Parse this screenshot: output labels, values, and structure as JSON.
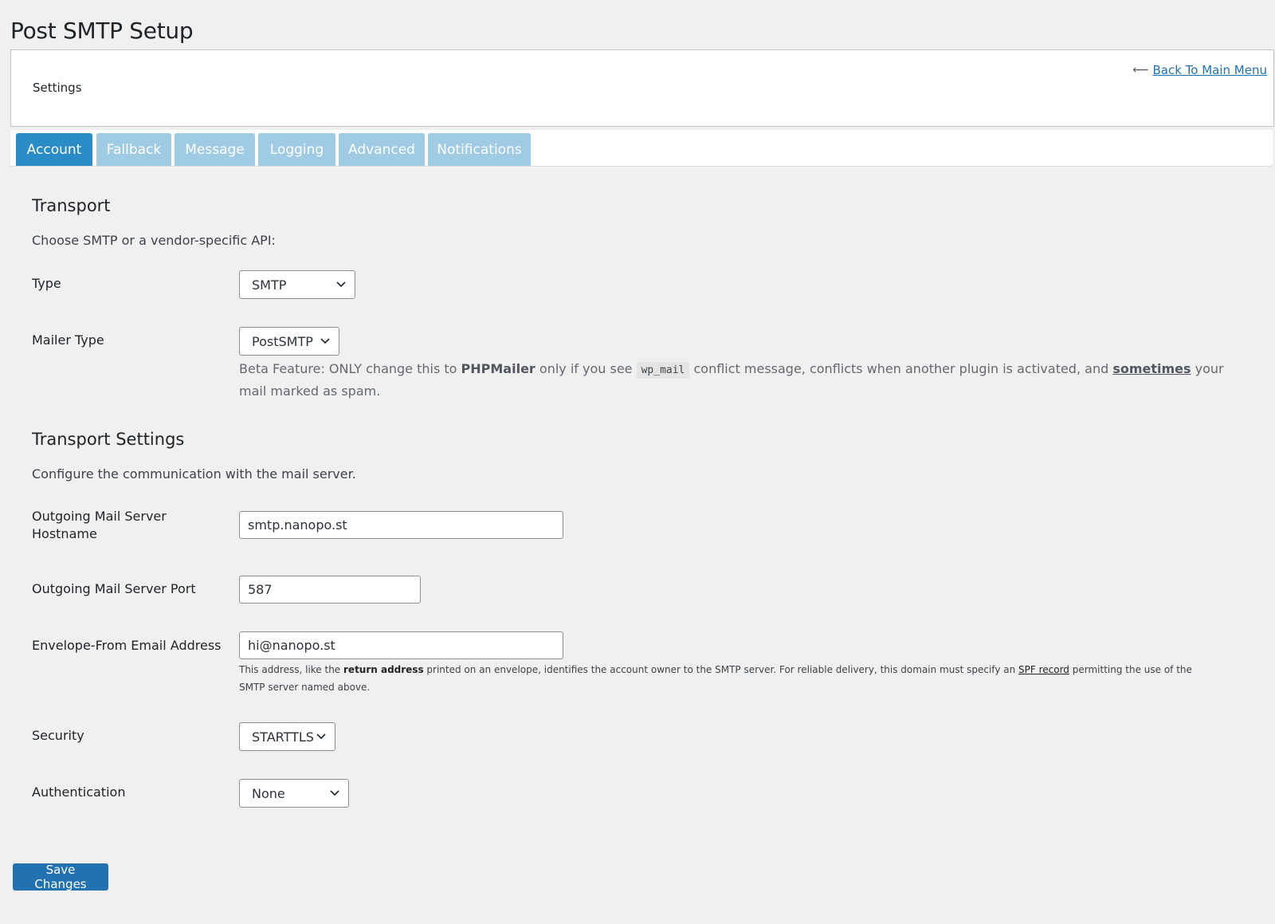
{
  "page": {
    "title": "Post SMTP Setup"
  },
  "header": {
    "settings_label": "Settings",
    "back_link": "Back To Main Menu"
  },
  "tabs": [
    {
      "label": "Account",
      "active": true
    },
    {
      "label": "Fallback",
      "active": false
    },
    {
      "label": "Message",
      "active": false
    },
    {
      "label": "Logging",
      "active": false
    },
    {
      "label": "Advanced",
      "active": false
    },
    {
      "label": "Notifications",
      "active": false
    }
  ],
  "transport": {
    "heading": "Transport",
    "description": "Choose SMTP or a vendor-specific API:",
    "type": {
      "label": "Type",
      "value": "SMTP"
    },
    "mailer_type": {
      "label": "Mailer Type",
      "value": "PostSMTP",
      "help_1": "Beta Feature: ONLY change this to ",
      "help_bold": "PHPMailer",
      "help_2": " only if you see ",
      "help_code": "wp_mail",
      "help_3": " conflict message, conflicts when another plugin is activated, and ",
      "help_underline": "sometimes",
      "help_4": " your mail marked as spam."
    }
  },
  "transport_settings": {
    "heading": "Transport Settings",
    "description": "Configure the communication with the mail server.",
    "hostname": {
      "label": "Outgoing Mail Server Hostname",
      "value": "smtp.nanopo.st"
    },
    "port": {
      "label": "Outgoing Mail Server Port",
      "value": "587"
    },
    "envelope_from": {
      "label": "Envelope-From Email Address",
      "value": "hi@nanopo.st",
      "help_1": "This address, like the ",
      "help_bold": "return address",
      "help_2": " printed on an envelope, identifies the account owner to the SMTP server. For reliable delivery, this domain must specify an ",
      "help_link": "SPF record",
      "help_3": " permitting the use of the SMTP server named above."
    },
    "security": {
      "label": "Security",
      "value": "STARTTLS"
    },
    "authentication": {
      "label": "Authentication",
      "value": "None"
    }
  },
  "footer": {
    "save_label": "Save Changes"
  },
  "colors": {
    "accent": "#2271b1",
    "tab_active": "#2a8cc6",
    "tab_inactive": "#a0cbe5",
    "background": "#f0f0f1"
  }
}
